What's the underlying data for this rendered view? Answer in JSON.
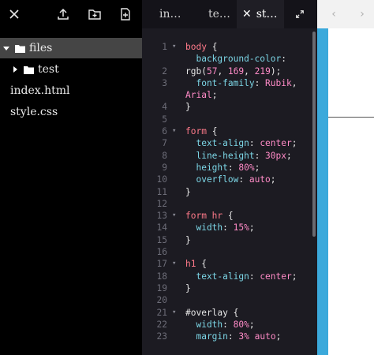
{
  "sidebar": {
    "toolbar": {
      "close_icon": "close-icon",
      "upload_icon": "upload-icon",
      "new_folder_icon": "new-folder-icon",
      "new_file_icon": "new-file-icon"
    },
    "tree": [
      {
        "label": "files",
        "type": "folder",
        "expanded": true,
        "selected": true
      },
      {
        "label": "test",
        "type": "folder",
        "expanded": false,
        "selected": false
      },
      {
        "label": "index.html",
        "type": "file",
        "selected": false
      },
      {
        "label": "style.css",
        "type": "file",
        "selected": false
      }
    ]
  },
  "tabs": [
    {
      "label": "in…",
      "active": false
    },
    {
      "label": "te…",
      "active": false
    },
    {
      "label": "st…",
      "active": true,
      "close": "✕"
    }
  ],
  "code_lines": [
    {
      "n": "1",
      "f": "▾",
      "parts": [
        [
          "sel",
          "body "
        ],
        [
          "plain",
          "{"
        ]
      ]
    },
    {
      "n": "",
      "f": "",
      "parts": [
        [
          "prop",
          "  background-color"
        ],
        [
          "plain",
          ":"
        ]
      ]
    },
    {
      "n": "2",
      "f": "",
      "parts": [
        [
          "plain",
          "rgb("
        ],
        [
          "val",
          "57"
        ],
        [
          "plain",
          ", "
        ],
        [
          "val",
          "169"
        ],
        [
          "plain",
          ", "
        ],
        [
          "val",
          "219"
        ],
        [
          "plain",
          ");"
        ]
      ]
    },
    {
      "n": "3",
      "f": "",
      "parts": [
        [
          "prop",
          "  font-family"
        ],
        [
          "plain",
          ": "
        ],
        [
          "val",
          "Rubik"
        ],
        [
          "plain",
          ","
        ]
      ]
    },
    {
      "n": "",
      "f": "",
      "parts": [
        [
          "val",
          "Arial"
        ],
        [
          "plain",
          ";"
        ]
      ]
    },
    {
      "n": "4",
      "f": "",
      "parts": [
        [
          "plain",
          "}"
        ]
      ]
    },
    {
      "n": "5",
      "f": "",
      "parts": []
    },
    {
      "n": "6",
      "f": "▾",
      "parts": [
        [
          "sel",
          "form "
        ],
        [
          "plain",
          "{"
        ]
      ]
    },
    {
      "n": "7",
      "f": "",
      "parts": [
        [
          "prop",
          "  text-align"
        ],
        [
          "plain",
          ": "
        ],
        [
          "val",
          "center"
        ],
        [
          "plain",
          ";"
        ]
      ]
    },
    {
      "n": "8",
      "f": "",
      "parts": [
        [
          "prop",
          "  line-height"
        ],
        [
          "plain",
          ": "
        ],
        [
          "val",
          "30px"
        ],
        [
          "plain",
          ";"
        ]
      ]
    },
    {
      "n": "9",
      "f": "",
      "parts": [
        [
          "prop",
          "  height"
        ],
        [
          "plain",
          ": "
        ],
        [
          "val",
          "80%"
        ],
        [
          "plain",
          ";"
        ]
      ]
    },
    {
      "n": "10",
      "f": "",
      "parts": [
        [
          "prop",
          "  overflow"
        ],
        [
          "plain",
          ": "
        ],
        [
          "val",
          "auto"
        ],
        [
          "plain",
          ";"
        ]
      ]
    },
    {
      "n": "11",
      "f": "",
      "parts": [
        [
          "plain",
          "}"
        ]
      ]
    },
    {
      "n": "12",
      "f": "",
      "parts": []
    },
    {
      "n": "13",
      "f": "▾",
      "parts": [
        [
          "sel",
          "form hr "
        ],
        [
          "plain",
          "{"
        ]
      ]
    },
    {
      "n": "14",
      "f": "",
      "parts": [
        [
          "prop",
          "  width"
        ],
        [
          "plain",
          ": "
        ],
        [
          "val",
          "15%"
        ],
        [
          "plain",
          ";"
        ]
      ]
    },
    {
      "n": "15",
      "f": "",
      "parts": [
        [
          "plain",
          "}"
        ]
      ]
    },
    {
      "n": "16",
      "f": "",
      "parts": []
    },
    {
      "n": "17",
      "f": "▾",
      "parts": [
        [
          "sel",
          "h1 "
        ],
        [
          "plain",
          "{"
        ]
      ]
    },
    {
      "n": "18",
      "f": "",
      "parts": [
        [
          "prop",
          "  text-align"
        ],
        [
          "plain",
          ": "
        ],
        [
          "val",
          "center"
        ],
        [
          "plain",
          ";"
        ]
      ]
    },
    {
      "n": "19",
      "f": "",
      "parts": [
        [
          "plain",
          "}"
        ]
      ]
    },
    {
      "n": "20",
      "f": "",
      "parts": []
    },
    {
      "n": "21",
      "f": "▾",
      "parts": [
        [
          "plain",
          "#overlay {"
        ]
      ]
    },
    {
      "n": "22",
      "f": "",
      "parts": [
        [
          "prop",
          "  width"
        ],
        [
          "plain",
          ": "
        ],
        [
          "val",
          "80%"
        ],
        [
          "plain",
          ";"
        ]
      ]
    },
    {
      "n": "23",
      "f": "",
      "parts": [
        [
          "prop",
          "  margin"
        ],
        [
          "plain",
          ": "
        ],
        [
          "val",
          "3%"
        ],
        [
          "plain",
          " "
        ],
        [
          "val",
          "auto"
        ],
        [
          "plain",
          ";"
        ]
      ]
    }
  ],
  "preview": {
    "back_label": "‹",
    "forward_label": "›",
    "background_color": "#3ba9db"
  },
  "colors": {
    "selector": "#ff7a8a",
    "property": "#7cd6e6",
    "value": "#ff8bc7",
    "sidebar_selected": "#454545"
  }
}
